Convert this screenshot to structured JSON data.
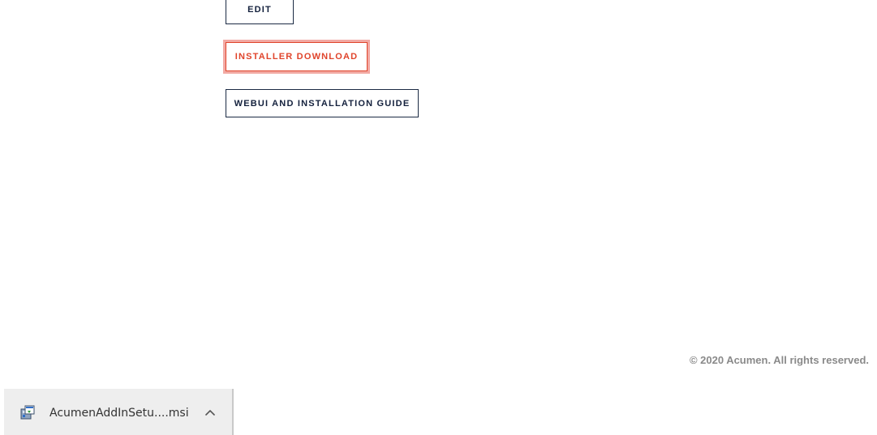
{
  "buttons": {
    "edit_label": "EDIT",
    "installer_label": "INSTALLER DOWNLOAD",
    "guide_label": "WEBUI AND INSTALLATION GUIDE"
  },
  "footer": {
    "copyright": "© 2020 Acumen. All rights reserved."
  },
  "download_bar": {
    "file_name": "AcumenAddInSetu....msi",
    "file_icon": "installer-package-icon",
    "expand_icon": "chevron-up-icon"
  },
  "colors": {
    "primary_text": "#14213d",
    "accent": "#e0442b",
    "focus_ring": "#f2a9a3",
    "footer_text": "#8a8a8a",
    "download_bar_bg": "#eeeeee"
  }
}
